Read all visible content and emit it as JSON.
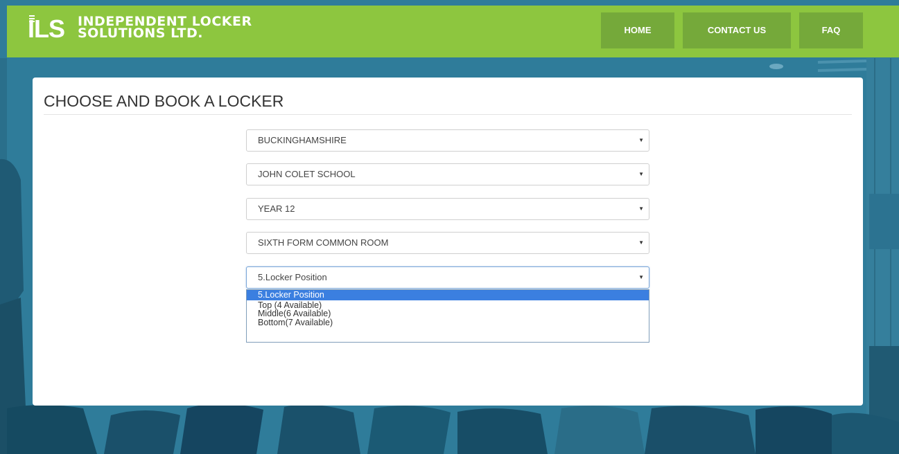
{
  "brand": {
    "mark": "ILS",
    "line1": "INDEPENDENT LOCKER",
    "line2": "SOLUTIONS LTD."
  },
  "nav": {
    "home": "HOME",
    "contact": "CONTACT US",
    "faq": "FAQ"
  },
  "card": {
    "title": "CHOOSE AND BOOK A LOCKER"
  },
  "selects": {
    "county": "BUCKINGHAMSHIRE",
    "school": "JOHN COLET SCHOOL",
    "year": "YEAR 12",
    "room": "SIXTH FORM COMMON ROOM",
    "position": "5.Locker Position"
  },
  "dropdown": {
    "options": [
      "5.Locker Position",
      "Top (4 Available)",
      "Middle(6 Available)",
      "Bottom(7 Available)"
    ]
  },
  "colors": {
    "header": "#8dc63f",
    "nav_button": "#75a93a",
    "background": "#2f7c9a",
    "highlight": "#3b7fe0"
  }
}
